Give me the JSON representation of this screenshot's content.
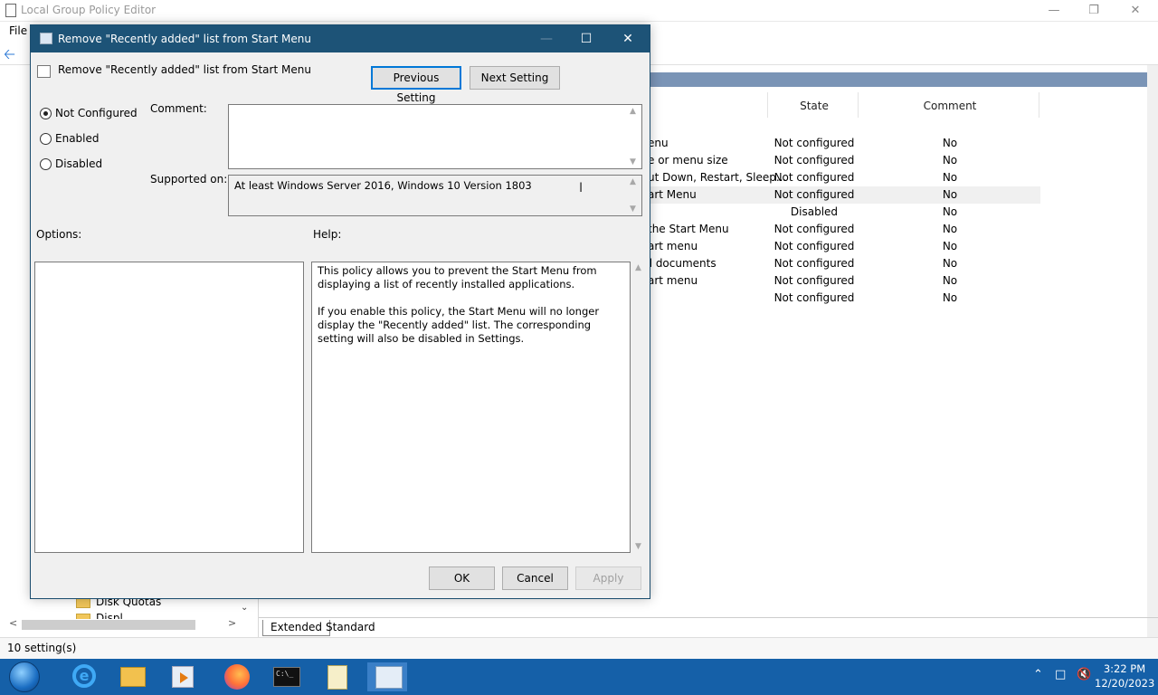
{
  "main_window": {
    "title": "Local Group Policy Editor",
    "menu_file": "File",
    "tree_items": [
      {
        "label": "Disk Quotas"
      },
      {
        "label": "Displ..."
      }
    ],
    "columns": {
      "state": "State",
      "comment": "Comment"
    },
    "rows": [
      {
        "name": "enu",
        "state": "Not configured",
        "comment": "No"
      },
      {
        "name": "e or menu size",
        "state": "Not configured",
        "comment": "No"
      },
      {
        "name": "ut Down, Restart, Sleep...",
        "state": "Not configured",
        "comment": "No"
      },
      {
        "name": "art Menu",
        "state": "Not configured",
        "comment": "No"
      },
      {
        "name": "",
        "state": "Disabled",
        "comment": "No"
      },
      {
        "name": "the Start Menu",
        "state": "Not configured",
        "comment": "No"
      },
      {
        "name": "art menu",
        "state": "Not configured",
        "comment": "No"
      },
      {
        "name": "ed documents",
        "state": "Not configured",
        "comment": "No"
      },
      {
        "name": "art menu",
        "state": "Not configured",
        "comment": "No"
      },
      {
        "name": "",
        "state": "Not configured",
        "comment": "No"
      }
    ],
    "tabs": [
      "Extended",
      "Standard"
    ],
    "status": "10 setting(s)"
  },
  "dialog": {
    "title": "Remove \"Recently added\" list from Start Menu",
    "header_title": "Remove \"Recently added\" list from Start Menu",
    "prev_button": "Previous Setting",
    "next_button": "Next Setting",
    "radios": {
      "not_configured": "Not Configured",
      "enabled": "Enabled",
      "disabled": "Disabled",
      "selected": "not_configured"
    },
    "comment_label": "Comment:",
    "comment_value": "",
    "supported_label": "Supported on:",
    "supported_value": "At least Windows Server 2016, Windows 10 Version 1803",
    "options_label": "Options:",
    "help_label": "Help:",
    "help_p1": "This policy allows you to prevent the Start Menu from displaying a list of recently installed applications.",
    "help_p2": "If you enable this policy, the Start Menu will no longer display the \"Recently added\" list.  The corresponding setting will also be disabled in Settings.",
    "ok": "OK",
    "cancel": "Cancel",
    "apply": "Apply"
  },
  "taskbar": {
    "cmd_text": "C:\\_",
    "clock_time": "3:22 PM",
    "clock_date": "12/20/2023"
  }
}
